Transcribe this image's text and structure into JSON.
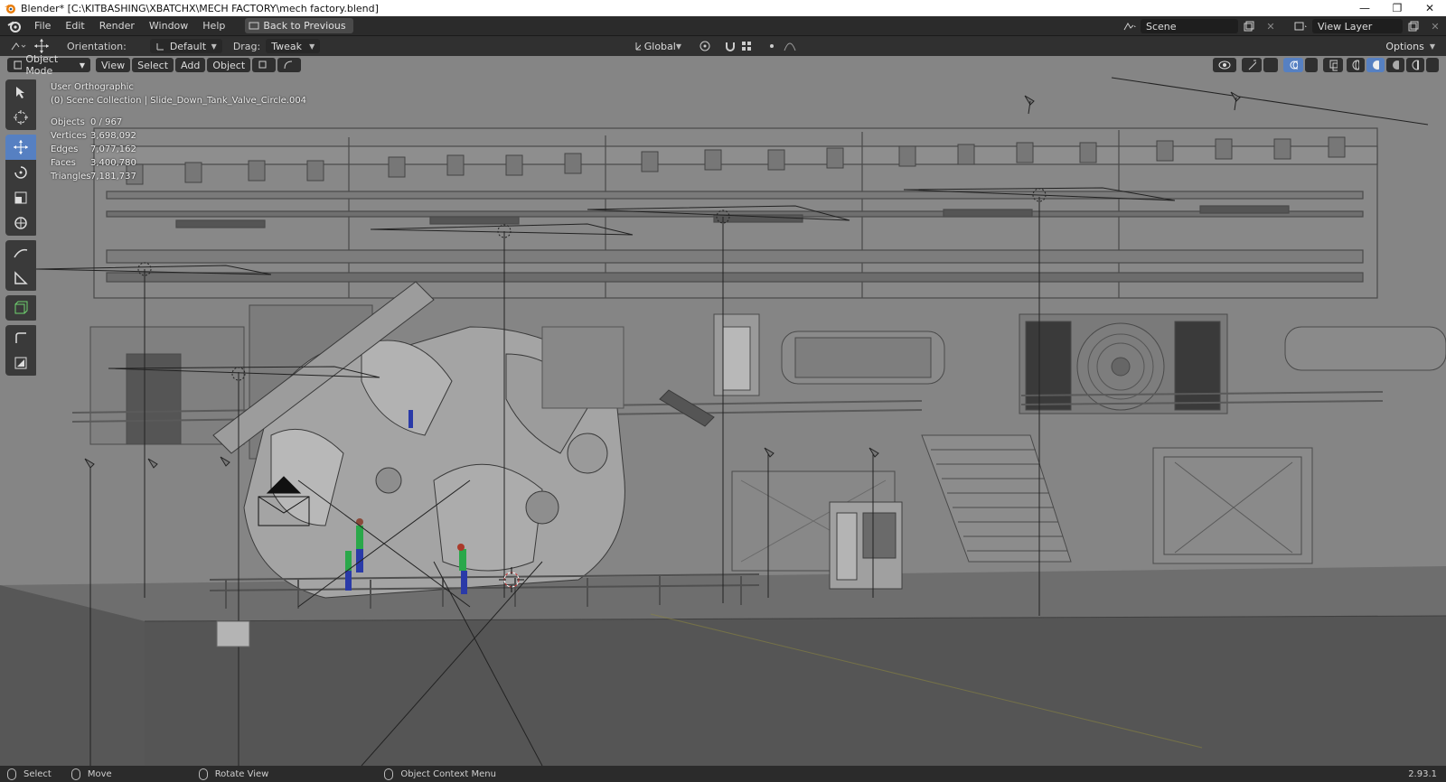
{
  "window": {
    "title": "Blender* [C:\\KITBASHING\\XBATCHX\\MECH FACTORY\\mech factory.blend]",
    "controls": [
      "minimize",
      "restore",
      "close"
    ]
  },
  "menubar": {
    "items": [
      "File",
      "Edit",
      "Render",
      "Window",
      "Help"
    ],
    "back_button": "Back to Previous",
    "scene_name": "Scene",
    "view_layer": "View Layer"
  },
  "toolheader": {
    "orientation_label": "Orientation:",
    "orientation_value": "Default",
    "drag_label": "Drag:",
    "drag_value": "Tweak",
    "transform_orientation": "Global",
    "options_label": "Options"
  },
  "vpheader": {
    "mode": "Object Mode",
    "menus": [
      "View",
      "Select",
      "Add",
      "Object"
    ]
  },
  "overlay": {
    "view_name": "User Orthographic",
    "collection": "(0) Scene Collection | Slide_Down_Tank_Valve_Circle.004"
  },
  "stats": [
    {
      "label": "Objects",
      "value": "0 / 967"
    },
    {
      "label": "Vertices",
      "value": "3,698,092"
    },
    {
      "label": "Edges",
      "value": "7,077,162"
    },
    {
      "label": "Faces",
      "value": "3,400,780"
    },
    {
      "label": "Triangles",
      "value": "7,181,737"
    }
  ],
  "toolbar": {
    "tools": [
      "select-box-tool",
      "cursor-tool",
      "move-tool",
      "rotate-tool",
      "scale-tool",
      "transform-tool",
      "annotate-tool",
      "measure-tool",
      "add-cube-tool",
      "shear-tool",
      "scale-cage-tool"
    ],
    "active": "move-tool"
  },
  "statusbar": {
    "hints": [
      "Select",
      "Move",
      "Rotate View",
      "Object Context Menu"
    ],
    "version": "2.93.1"
  },
  "colors": {
    "accent": "#5680c2",
    "viewport_bg": "#858585",
    "floor": "#555555"
  }
}
